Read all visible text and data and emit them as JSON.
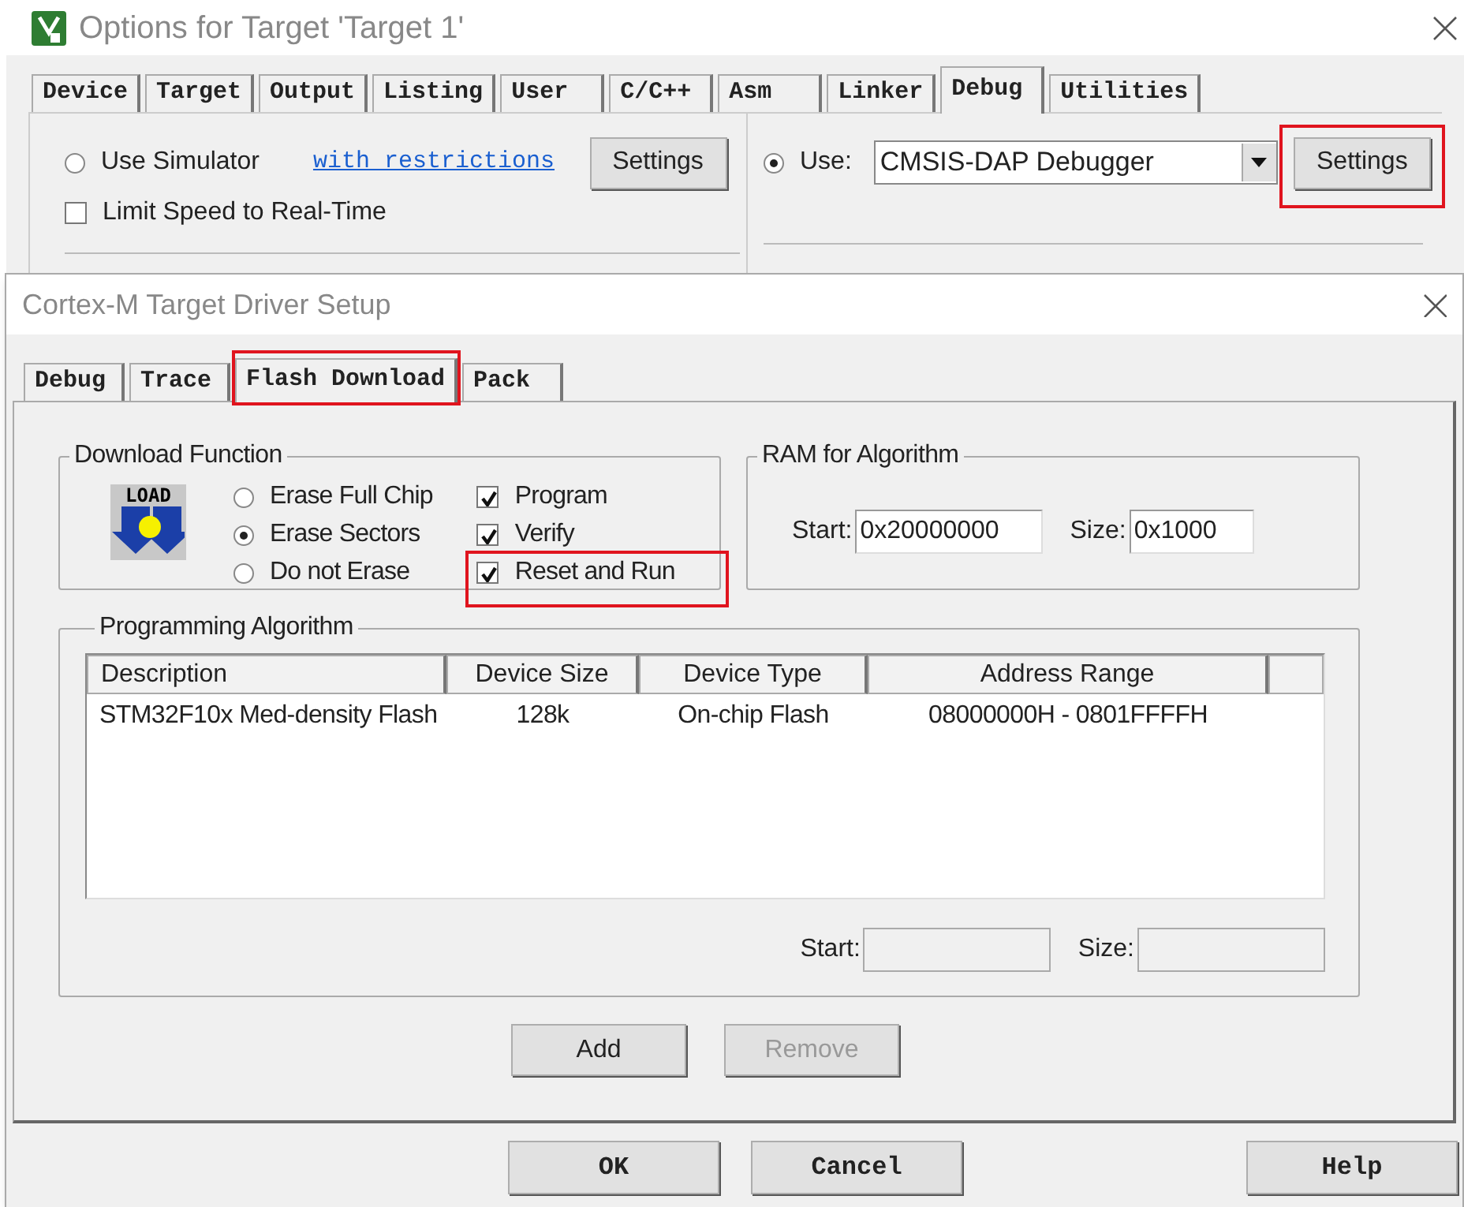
{
  "back_window": {
    "title": "Options for Target 'Target 1'",
    "tabs": [
      {
        "label": "Device",
        "selected": false
      },
      {
        "label": "Target",
        "selected": false
      },
      {
        "label": "Output",
        "selected": false
      },
      {
        "label": "Listing",
        "selected": false
      },
      {
        "label": "User",
        "selected": false
      },
      {
        "label": "C/C++",
        "selected": false
      },
      {
        "label": "Asm",
        "selected": false
      },
      {
        "label": "Linker",
        "selected": false
      },
      {
        "label": "Debug",
        "selected": true
      },
      {
        "label": "Utilities",
        "selected": false
      }
    ],
    "simulator": {
      "label": "Use Simulator",
      "selected": false
    },
    "restrictions_link": "with restrictions",
    "simulator_settings": {
      "label": "Settings",
      "highlighted": false
    },
    "limit_speed": {
      "label": "Limit Speed to Real-Time",
      "checked": false
    },
    "use_debugger": {
      "label": "Use:",
      "selected": true
    },
    "debugger": {
      "value": "CMSIS-DAP Debugger"
    },
    "debugger_settings": {
      "label": "Settings",
      "highlighted": true
    }
  },
  "dialog": {
    "title": "Cortex-M Target Driver Setup",
    "tabs": [
      {
        "label": "Debug",
        "selected": false,
        "highlighted": false
      },
      {
        "label": "Trace",
        "selected": false,
        "highlighted": false
      },
      {
        "label": "Flash Download",
        "selected": true,
        "highlighted": true
      },
      {
        "label": "Pack",
        "selected": false,
        "highlighted": false
      }
    ],
    "download_function": {
      "title": "Download Function",
      "icon_text": "LOAD",
      "erase_options": [
        {
          "label": "Erase Full Chip",
          "selected": false
        },
        {
          "label": "Erase Sectors",
          "selected": true
        },
        {
          "label": "Do not Erase",
          "selected": false
        }
      ],
      "options": [
        {
          "label": "Program",
          "checked": true,
          "highlighted": false
        },
        {
          "label": "Verify",
          "checked": true,
          "highlighted": false
        },
        {
          "label": "Reset and Run",
          "checked": true,
          "highlighted": true
        }
      ]
    },
    "ram": {
      "title": "RAM for Algorithm",
      "start_label": "Start:",
      "start": "0x20000000",
      "size_label": "Size:",
      "size": "0x1000"
    },
    "algorithm": {
      "title": "Programming Algorithm",
      "columns": [
        "Description",
        "Device Size",
        "Device Type",
        "Address Range"
      ],
      "rows": [
        [
          "STM32F10x Med-density Flash",
          "128k",
          "On-chip Flash",
          "08000000H - 0801FFFFH"
        ]
      ],
      "start_label": "Start:",
      "size_label": "Size:"
    },
    "buttons": [
      {
        "label": "Add",
        "disabled": false
      },
      {
        "label": "Remove",
        "disabled": true
      }
    ]
  },
  "footer_buttons": [
    {
      "label": "OK"
    },
    {
      "label": "Cancel"
    },
    {
      "label": "Help"
    }
  ]
}
